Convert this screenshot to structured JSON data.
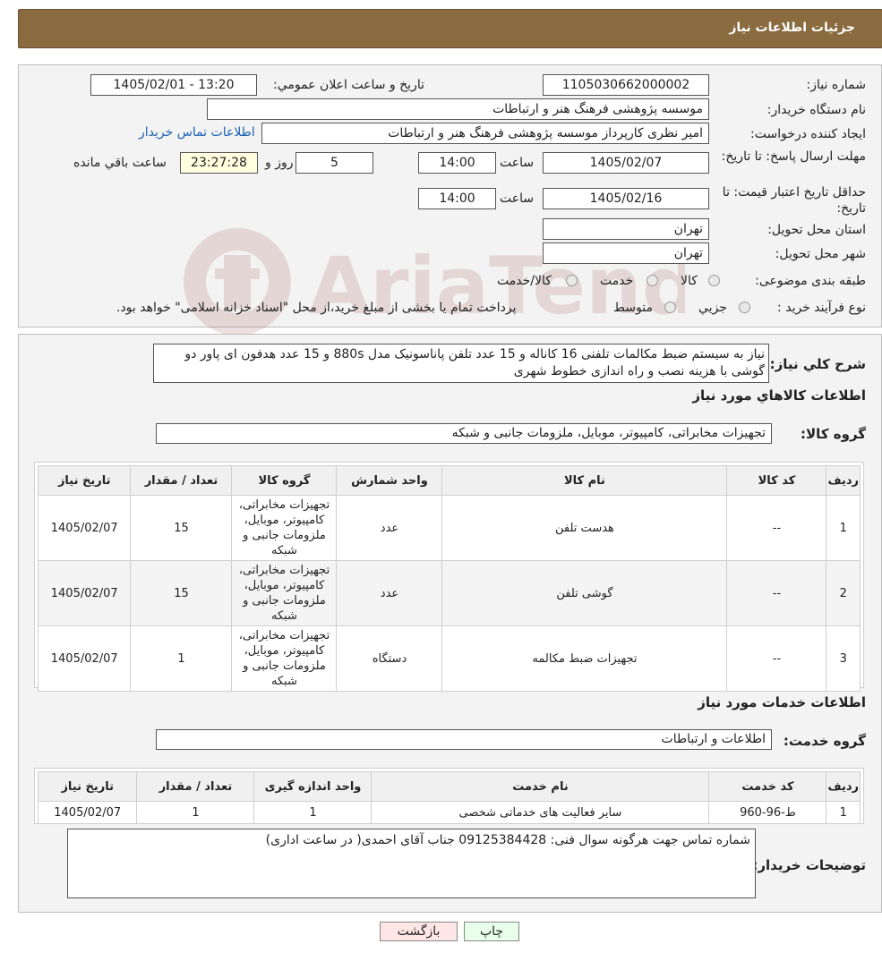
{
  "page": {
    "title": "جزئیات اطلاعات نیاز"
  },
  "header": {
    "need_number_label": "شماره نیاز:",
    "need_number": "1105030662000002",
    "announce_label": "تاریخ و ساعت اعلان عمومي:",
    "announce_value": "1405/02/01 - 13:20",
    "buyer_label": "نام دستگاه خريدار:",
    "buyer_value": "موسسه پژوهشی فرهنگ  هنر و ارتباطات",
    "creator_label": "ايجاد کننده درخواست:",
    "creator_value": "امیر نظری کارپرداز موسسه پژوهشی فرهنگ  هنر و ارتباطات",
    "contact_link": "اطلاعات تماس خريدار",
    "deadline_label": "مهلت ارسال پاسخ: تا تاریخ:",
    "deadline_date": "1405/02/07",
    "time_label": "ساعت",
    "deadline_time": "14:00",
    "days_value": "5",
    "days_label": "روز و",
    "remaining_time": "23:27:28",
    "remaining_label": "ساعت باقي مانده",
    "validity_label": "حداقل تاريخ اعتبار قيمت: تا تاريخ:",
    "validity_date": "1405/02/16",
    "validity_time": "14:00",
    "province_label": "استان محل تحويل:",
    "province_value": "تهران",
    "city_label": "شهر محل تحويل:",
    "city_value": "تهران",
    "category_label": "طبقه بندی موضوعی:",
    "category_options": [
      "کالا",
      "خدمت",
      "کالا/خدمت"
    ],
    "process_label": "نوع فرآیند خرید :",
    "process_options": [
      "جزيي",
      "متوسط"
    ],
    "process_note": "پرداخت تمام یا بخشی از مبلغ خرید،از محل \"اسناد خزانه اسلامی\" خواهد بود."
  },
  "description": {
    "label": "شرح کلي نياز:",
    "text": "نیاز به سیستم ضبط مکالمات تلفنی 16 کاناله و 15 عدد تلفن پاناسونیک مدل 880s و 15 عدد هدفون ای پاور دو گوشی با هزینه نصب و راه اندازی خطوط شهری"
  },
  "goods": {
    "section_title": "اطلاعات کالاهاي مورد نياز",
    "group_label": "گروه کالا:",
    "group_value": "تجهیزات مخابراتی، کامپیوتر، موبایل، ملزومات جانبی و شبکه",
    "columns": [
      "رديف",
      "کد کالا",
      "نام کالا",
      "واحد شمارش",
      "گروه کالا",
      "تعداد / مقدار",
      "تاريخ نياز"
    ],
    "rows": [
      {
        "row": "1",
        "code": "--",
        "name": "هدست تلفن",
        "unit": "عدد",
        "group": "تجهیزات مخابراتی، کامپیوتر، موبایل، ملزومات جانبی و شبکه",
        "qty": "15",
        "date": "1405/02/07"
      },
      {
        "row": "2",
        "code": "--",
        "name": "گوشی تلفن",
        "unit": "عدد",
        "group": "تجهیزات مخابراتی، کامپیوتر، موبایل، ملزومات جانبی و شبکه",
        "qty": "15",
        "date": "1405/02/07"
      },
      {
        "row": "3",
        "code": "--",
        "name": "تجهیزات ضبط مکالمه",
        "unit": "دستگاه",
        "group": "تجهیزات مخابراتی، کامپیوتر، موبایل، ملزومات جانبی و شبکه",
        "qty": "1",
        "date": "1405/02/07"
      }
    ]
  },
  "services": {
    "section_title": "اطلاعات خدمات مورد نياز",
    "group_label": "گروه خدمت:",
    "group_value": "اطلاعات و ارتباطات",
    "columns": [
      "رديف",
      "کد خدمت",
      "نام خدمت",
      "واحد اندازه گيری",
      "تعداد / مقدار",
      "تاريخ نياز"
    ],
    "rows": [
      {
        "row": "1",
        "code": "ط-96-960",
        "name": "ساير فعاليت های خدماتی شخصی",
        "unit": "1",
        "qty": "1",
        "date": "1405/02/07"
      }
    ]
  },
  "buyer_notes": {
    "label": "توضيحات خريدار:",
    "text": "شماره تماس جهت هرگونه سوال فنی: 09125384428 جناب آقای احمدی( در ساعت اداری)"
  },
  "buttons": {
    "print": "چاپ",
    "back": "بازگشت"
  },
  "watermark": {
    "text": "AriaTender.neT"
  },
  "colors": {
    "title_bar": "#8a6a3f",
    "link": "#1a5fb4",
    "print_button": "#eaffea",
    "back_button": "#ffe6e6"
  }
}
